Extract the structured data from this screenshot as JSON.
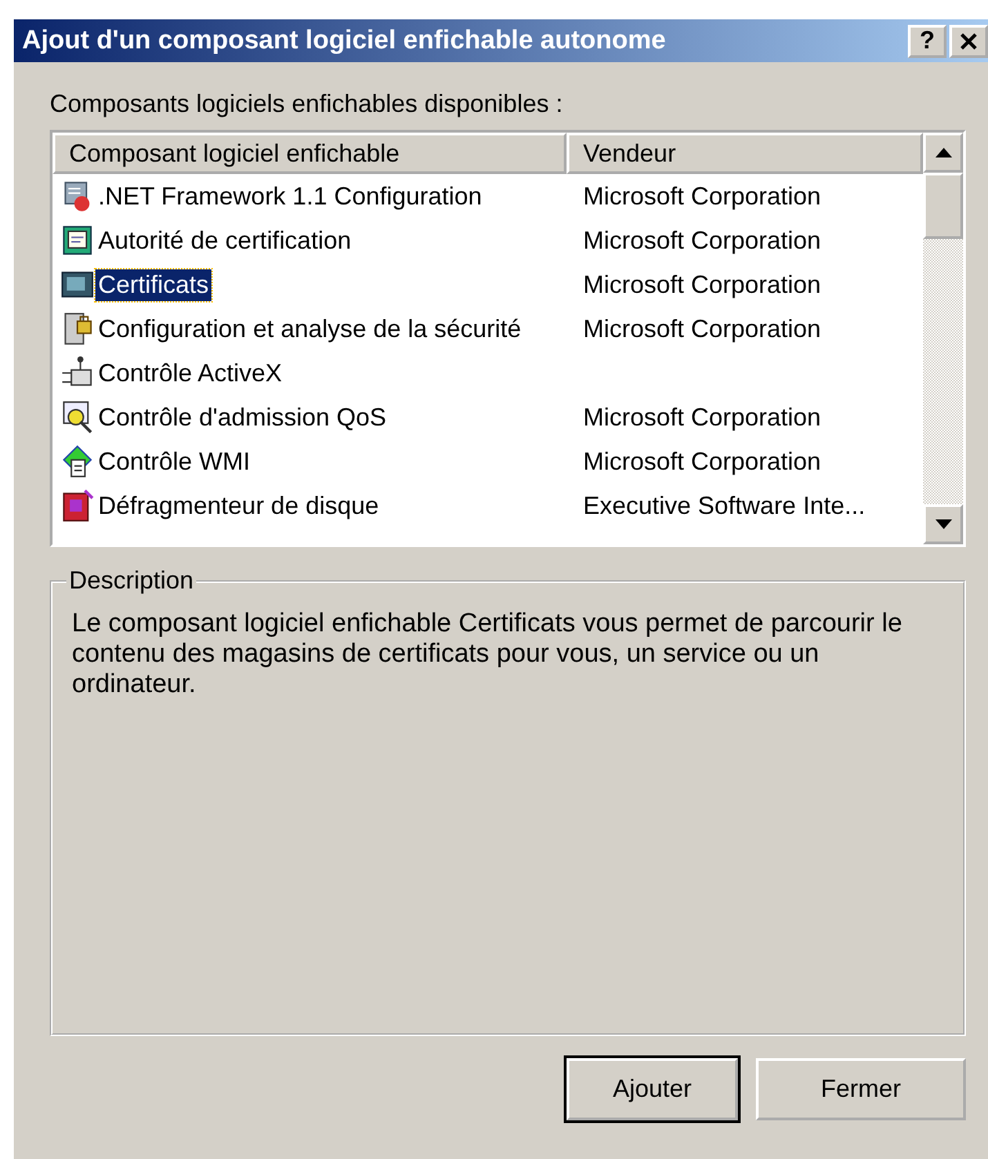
{
  "window": {
    "title": "Ajout d'un composant logiciel enfichable autonome",
    "help_button": "?"
  },
  "list_label": "Composants logiciels enfichables disponibles :",
  "table": {
    "columns": [
      "Composant logiciel enfichable",
      "Vendeur"
    ],
    "rows": [
      {
        "name": ".NET Framework 1.1 Configuration",
        "vendor": "Microsoft Corporation",
        "selected": false
      },
      {
        "name": "Autorité de certification",
        "vendor": "Microsoft Corporation",
        "selected": false
      },
      {
        "name": "Certificats",
        "vendor": "Microsoft Corporation",
        "selected": true
      },
      {
        "name": "Configuration et analyse de la sécurité",
        "vendor": "Microsoft Corporation",
        "selected": false
      },
      {
        "name": "Contrôle ActiveX",
        "selected": false
      },
      {
        "name": "Contrôle d'admission QoS",
        "vendor": "Microsoft Corporation",
        "selected": false
      },
      {
        "name": "Contrôle WMI",
        "vendor": "Microsoft Corporation",
        "selected": false
      },
      {
        "name": "Défragmenteur de disque",
        "vendor": "Executive Software Inte...",
        "selected": false
      }
    ]
  },
  "description": {
    "legend": "Description",
    "text": "Le composant logiciel enfichable Certificats vous permet de parcourir le contenu des magasins de certificats pour vous, un service ou un ordinateur."
  },
  "buttons": [
    {
      "label": "Ajouter",
      "default": true
    },
    {
      "label": "Fermer",
      "default": false
    }
  ]
}
